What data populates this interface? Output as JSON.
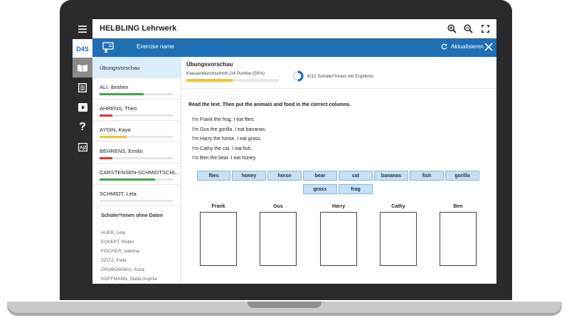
{
  "app": {
    "title": "HELBLING Lehrwerk",
    "logo": "D4S"
  },
  "exercise": {
    "name": "Exercise name",
    "refresh_label": "Aktualisieren"
  },
  "rail": [
    "menu-icon",
    "book-icon",
    "worksheet-icon",
    "play-icon",
    "help-icon",
    "dictionary-icon"
  ],
  "preview": {
    "title": "Übungsvorschau",
    "avg_label": "Klassendurchschnitt 2/4 Punkte (50%)",
    "avg_fraction": 0.5,
    "results_label": "6/12 Schüler*innen mit Ergebnis",
    "results_fraction": 0.5
  },
  "students": [
    {
      "name": "Übungsvorschau",
      "selected": true
    },
    {
      "name": "ALI, Ibrahim",
      "score": 0.6,
      "color": "#3aa845"
    },
    {
      "name": "AHRENS, Theo",
      "score": 0.17,
      "color": "#e0312b"
    },
    {
      "name": "AYDIN, Kaya",
      "score": 0.37,
      "color": "#f2c230"
    },
    {
      "name": "BEHRENS, Emilio",
      "score": 0.17,
      "color": "#e0312b"
    },
    {
      "name": "CARSTENSEN-SCHMIDTSCHL...",
      "score": 0.75,
      "color": "#3aa845"
    },
    {
      "name": "SCHMIDT, Lela",
      "score": 0,
      "color": "#e6e6e6"
    }
  ],
  "no_data": {
    "title": "Schüler*innen ohne Daten",
    "names": [
      "AUER, Lela",
      "ECKERT, Robin",
      "FISCHER, Adelina",
      "GÖTZ, Fiete",
      "GRABOWSKA, Anna",
      "HOFFMANN, Stella-Sophie"
    ]
  },
  "task": {
    "instruction": "Read the text. Then put the animals and food in the correct columns.",
    "sentences": [
      "I'm Frank the frog. I eat flies.",
      "I'm Gus the gorilla. I eat bananas.",
      "I'm Harry the horse. I eat grass.",
      "I'm Cathy the cat. I eat fish.",
      "I'm Ben the bear. I eat honey."
    ],
    "words": [
      "flies",
      "honey",
      "horse",
      "bear",
      "cat",
      "bananas",
      "fish",
      "gorilla",
      "grass",
      "frog"
    ],
    "columns": [
      "Frank",
      "Gus",
      "Harry",
      "Cathy",
      "Ben"
    ]
  }
}
